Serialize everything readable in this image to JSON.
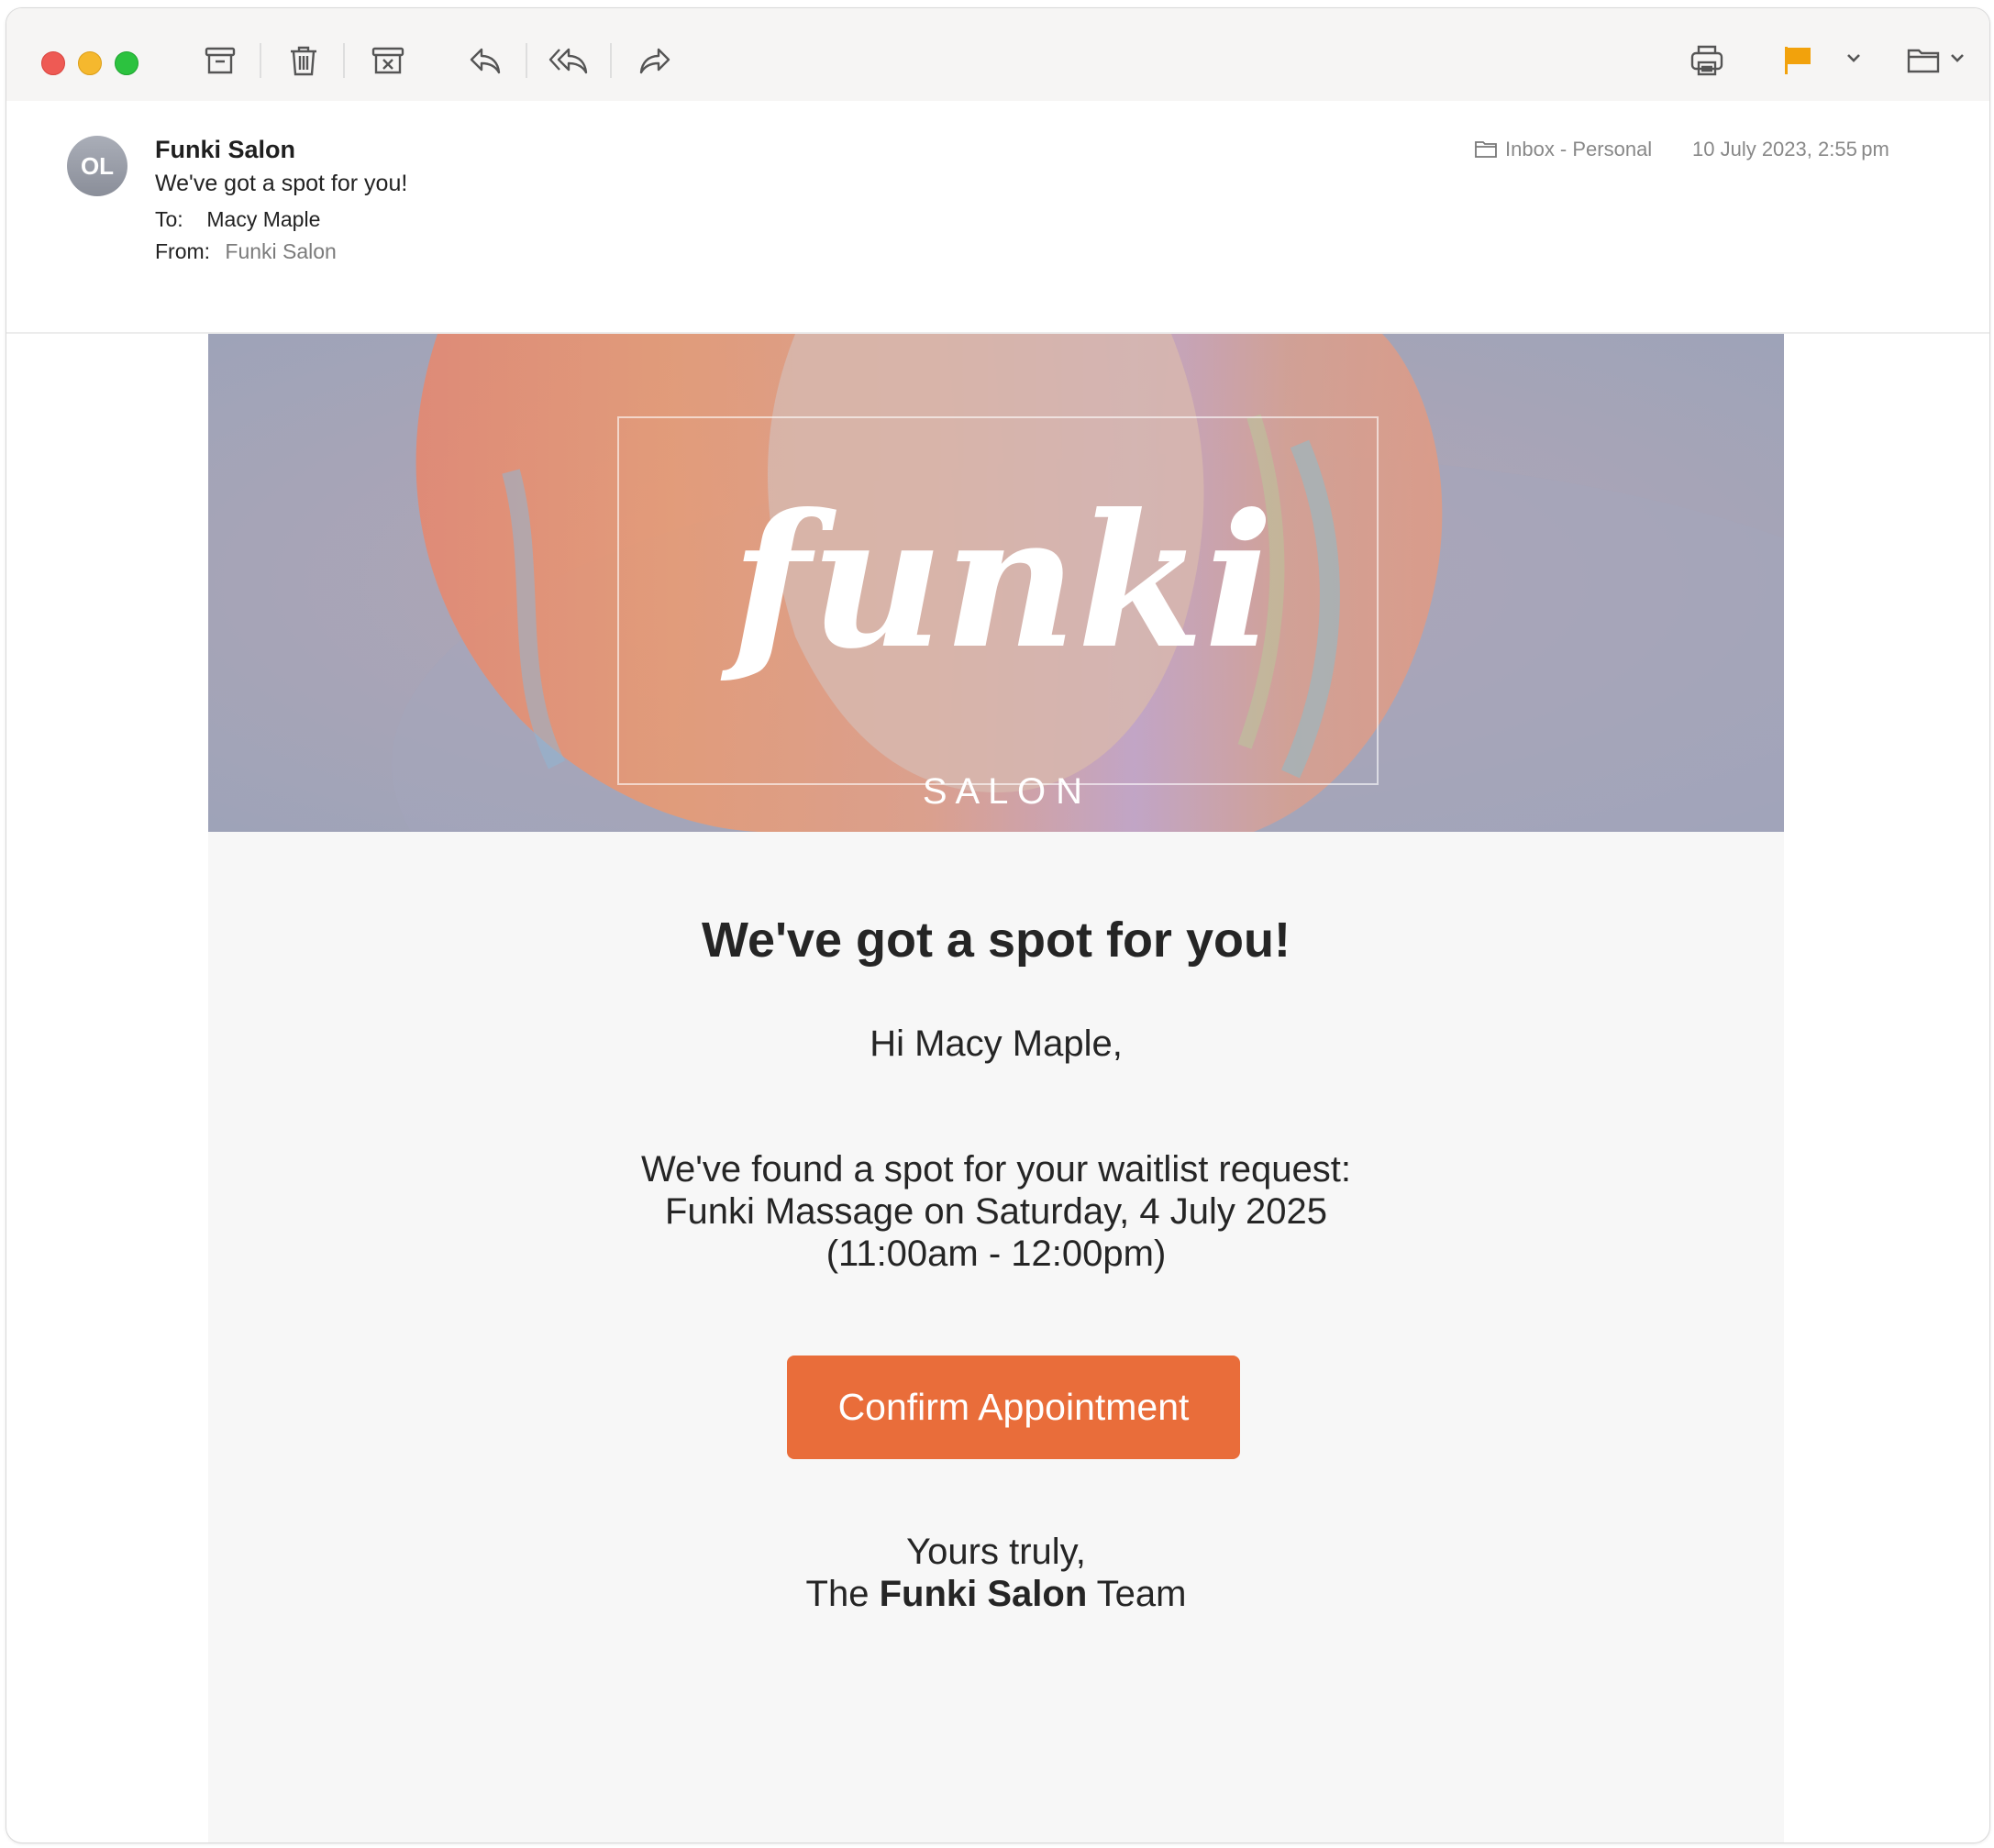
{
  "toolbar": {
    "buttons": [
      "archive-icon",
      "trash-icon",
      "junk-icon",
      "reply-icon",
      "reply-all-icon",
      "forward-icon",
      "print-icon",
      "flag-icon",
      "move-to-folder-icon"
    ],
    "flag_color": "#f2a20c"
  },
  "header": {
    "avatar_initials": "OL",
    "sender_name": "Funki Salon",
    "subject": "We've got a spot for you!",
    "to_label": "To:",
    "to_value": "Macy Maple",
    "from_label": "From:",
    "from_value": "Funki Salon",
    "mailbox": "Inbox - Personal",
    "datetime": "10 July 2023, 2:55 pm"
  },
  "email": {
    "banner_logo": "funki",
    "banner_subtitle": "S A L O N",
    "headline": "We've got a spot for you!",
    "greeting": "Hi Macy Maple,",
    "message_line1": "We've found a spot for your waitlist request:",
    "message_line2": "Funki Massage on Saturday, 4 July 2025",
    "message_line3": "(11:00am - 12:00pm)",
    "cta_label": "Confirm Appointment",
    "cta_color": "#e96d3a",
    "signoff_line1": "Yours truly,",
    "signoff_prefix": "The ",
    "signoff_brand": "Funki Salon",
    "signoff_suffix": " Team"
  }
}
